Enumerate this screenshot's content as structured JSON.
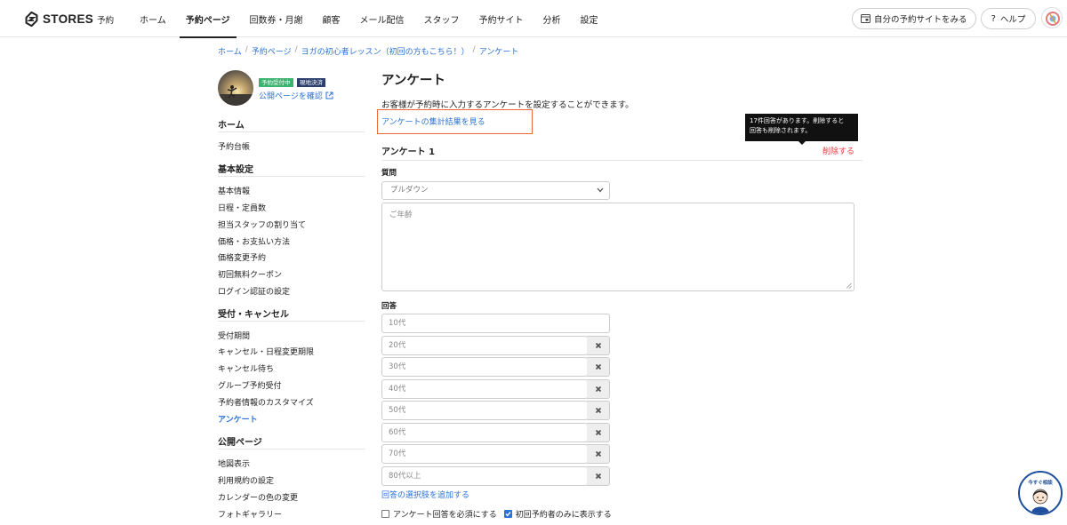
{
  "header": {
    "logo_text": "STORES",
    "logo_sub": "予約",
    "nav": [
      {
        "label": "ホーム",
        "active": false
      },
      {
        "label": "予約ページ",
        "active": true
      },
      {
        "label": "回数券・月謝",
        "active": false
      },
      {
        "label": "顧客",
        "active": false
      },
      {
        "label": "メール配信",
        "active": false
      },
      {
        "label": "スタッフ",
        "active": false
      },
      {
        "label": "予約サイト",
        "active": false
      },
      {
        "label": "分析",
        "active": false
      },
      {
        "label": "設定",
        "active": false
      }
    ],
    "site_button": "自分の予約サイトをみる",
    "help_button": "ヘルプ",
    "help_icon": "?"
  },
  "breadcrumb": [
    "ホーム",
    "予約ページ",
    "ヨガの初心者レッスン（初回の方もこちら！）",
    "アンケート"
  ],
  "breadcrumb_sep": "/",
  "sidebar": {
    "badges": [
      "予約受付中",
      "現地決済"
    ],
    "public_link": "公開ページを確認",
    "sections": [
      {
        "title": "ホーム",
        "items": [
          {
            "label": "予約台帳",
            "active": false
          }
        ]
      },
      {
        "title": "基本設定",
        "items": [
          {
            "label": "基本情報",
            "active": false
          },
          {
            "label": "日程・定員数",
            "active": false
          },
          {
            "label": "担当スタッフの割り当て",
            "active": false
          },
          {
            "label": "価格・お支払い方法",
            "active": false
          },
          {
            "label": "価格変更予約",
            "active": false
          },
          {
            "label": "初回無料クーポン",
            "active": false
          },
          {
            "label": "ログイン認証の設定",
            "active": false
          }
        ]
      },
      {
        "title": "受付・キャンセル",
        "items": [
          {
            "label": "受付期間",
            "active": false
          },
          {
            "label": "キャンセル・日程変更期限",
            "active": false
          },
          {
            "label": "キャンセル待ち",
            "active": false
          },
          {
            "label": "グループ予約受付",
            "active": false
          },
          {
            "label": "予約者情報のカスタマイズ",
            "active": false
          },
          {
            "label": "アンケート",
            "active": true
          }
        ]
      },
      {
        "title": "公開ページ",
        "items": [
          {
            "label": "地図表示",
            "active": false
          },
          {
            "label": "利用規約の設定",
            "active": false
          },
          {
            "label": "カレンダーの色の変更",
            "active": false
          },
          {
            "label": "フォトギャラリー",
            "active": false
          }
        ]
      }
    ]
  },
  "main": {
    "title": "アンケート",
    "description": "お客様が予約時に入力するアンケートを設定することができます。",
    "results_link": "アンケートの集計結果を見る",
    "tooltip_lines": [
      "17件回答があります。削除すると",
      "回答も削除されます。"
    ],
    "survey_title": "アンケート 1",
    "delete_label": "削除する",
    "question_label": "質問",
    "question_type": "プルダウン",
    "question_placeholder": "ご年齢",
    "answer_label": "回答",
    "answers": [
      "10代",
      "20代",
      "30代",
      "40代",
      "50代",
      "60代",
      "70代",
      "80代以上"
    ],
    "add_choice": "回答の選択肢を追加する",
    "required_label": "アンケート回答を必須にする",
    "required_checked": false,
    "first_only_label": "初回予約者のみに表示する",
    "first_only_checked": true
  },
  "chat_widget": {
    "label": "今すぐ相談"
  },
  "colors": {
    "link": "#2a72d6",
    "danger": "#e8383d",
    "highlight": "#ec6a3a",
    "badge_open": "#3cb371",
    "badge_pay": "#2c3e6b"
  },
  "icons": [
    "stores-logo-icon",
    "site-window-icon",
    "help-icon",
    "external-link-icon",
    "chevron-down-icon",
    "remove-x-icon",
    "check-icon",
    "resize-grip-icon"
  ]
}
